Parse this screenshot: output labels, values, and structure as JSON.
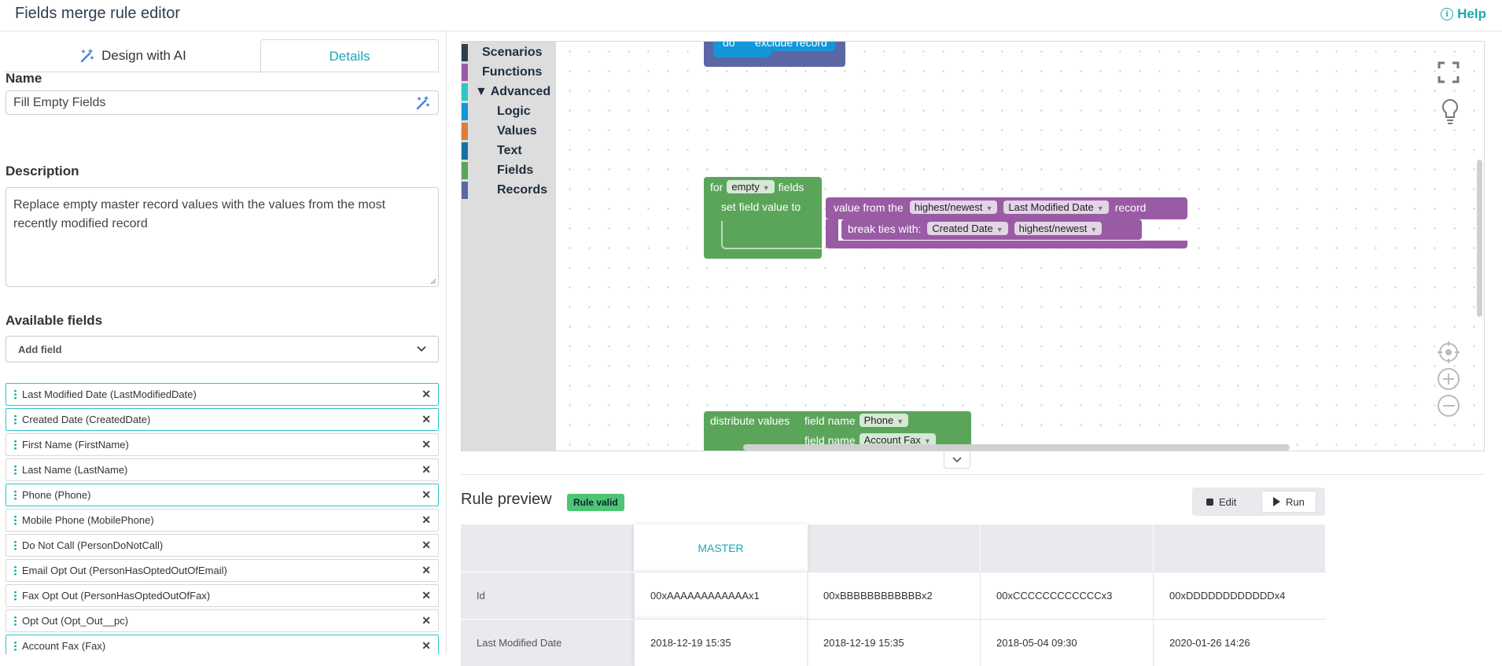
{
  "header": {
    "title": "Fields merge rule editor",
    "help": "Help"
  },
  "tabs": {
    "design_ai": "Design with AI",
    "details": "Details"
  },
  "form": {
    "name_label": "Name",
    "name_value": "Fill Empty Fields",
    "description_label": "Description",
    "description_value": "Replace empty master record values with the values from the most recently modified record",
    "available_label": "Available fields",
    "add_field_placeholder": "Add field"
  },
  "fields": [
    {
      "label": "Last Modified Date (LastModifiedDate)",
      "highlighted": true
    },
    {
      "label": "Created Date (CreatedDate)",
      "highlighted": true
    },
    {
      "label": "First Name (FirstName)",
      "highlighted": false
    },
    {
      "label": "Last Name (LastName)",
      "highlighted": false
    },
    {
      "label": "Phone (Phone)",
      "highlighted": true
    },
    {
      "label": "Mobile Phone (MobilePhone)",
      "highlighted": false
    },
    {
      "label": "Do Not Call (PersonDoNotCall)",
      "highlighted": false
    },
    {
      "label": "Email Opt Out (PersonHasOptedOutOfEmail)",
      "highlighted": false
    },
    {
      "label": "Fax Opt Out (PersonHasOptedOutOfFax)",
      "highlighted": false
    },
    {
      "label": "Opt Out (Opt_Out__pc)",
      "highlighted": false
    },
    {
      "label": "Account Fax (Fax)",
      "highlighted": true
    }
  ],
  "toolbox": [
    {
      "label": "Scenarios",
      "color": "#2c3e50",
      "indent": false
    },
    {
      "label": "Functions",
      "color": "#9a5ba5",
      "indent": false
    },
    {
      "label": "▼ Advanced",
      "color": "#2ec5ca",
      "indent": false
    },
    {
      "label": "Logic",
      "color": "#1496d8",
      "indent": true
    },
    {
      "label": "Values",
      "color": "#e07b3c",
      "indent": true
    },
    {
      "label": "Text",
      "color": "#1a6fa8",
      "indent": true
    },
    {
      "label": "Fields",
      "color": "#5ba55b",
      "indent": true
    },
    {
      "label": "Records",
      "color": "#5b67a5",
      "indent": true
    }
  ],
  "blocks": {
    "top_do": "do",
    "top_exclude": "exclude record",
    "for": "for",
    "empty": "empty",
    "fields": "fields",
    "set_field": "set field value to",
    "value_from": "value from the",
    "highest_newest": "highest/newest",
    "last_modified": "Last Modified Date",
    "record": "record",
    "break_ties": "break ties with:",
    "created_date": "Created Date",
    "highest_newest2": "highest/newest",
    "distribute": "distribute values",
    "field_name": "field name",
    "phone": "Phone",
    "field_name2": "field name",
    "account_fax": "Account Fax"
  },
  "preview": {
    "title": "Rule preview",
    "badge": "Rule valid",
    "edit": "Edit",
    "run": "Run"
  },
  "table": {
    "columns": [
      "MASTER",
      "",
      "",
      ""
    ],
    "rows": [
      {
        "label": "Id",
        "values": [
          "00xAAAAAAAAAAAAx1",
          "00xBBBBBBBBBBBBx2",
          "00xCCCCCCCCCCCCx3",
          "00xDDDDDDDDDDDDx4"
        ]
      },
      {
        "label": "Last Modified Date",
        "values": [
          "2018-12-19 15:35",
          "2018-12-19 15:35",
          "2018-05-04 09:30",
          "2020-01-26 14:26"
        ]
      }
    ]
  },
  "colors": {
    "accent": "#17a9b3",
    "green_badge": "#4cc674",
    "block_green": "#5ba55b",
    "block_purple": "#9a5ba5"
  }
}
